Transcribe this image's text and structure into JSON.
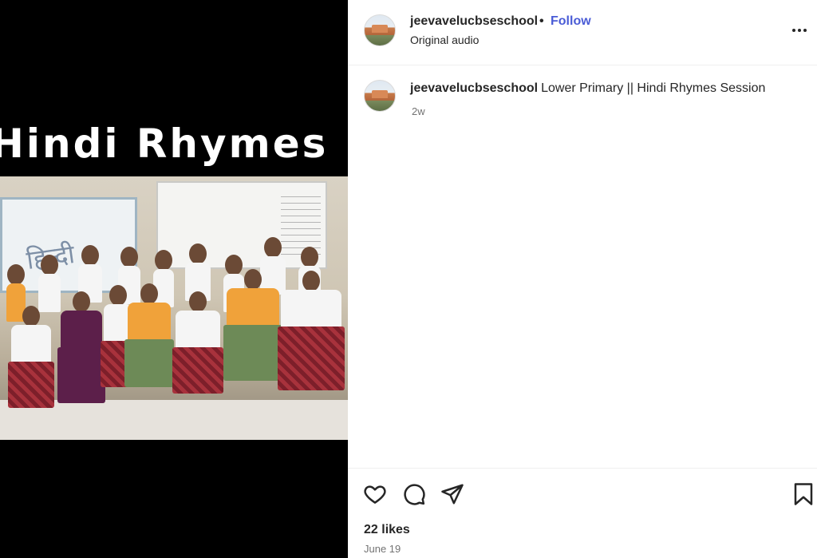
{
  "post": {
    "username": "jeevavelucbseschool",
    "separator": "•",
    "follow_label": "Follow",
    "audio": "Original audio"
  },
  "media": {
    "title_text": "Hindi Rhymes",
    "board_text": "हिन्दी"
  },
  "caption": {
    "username": "jeevavelucbseschool",
    "text": "Lower Primary || Hindi Rhymes Session",
    "age": "2w"
  },
  "actions": {
    "likes": "22 likes",
    "date": "June 19"
  },
  "colors": {
    "follow": "#4a5cd6",
    "media_bg": "#000000",
    "muted": "#737373",
    "text": "#262626"
  },
  "icons": [
    "more-options-icon",
    "heart-icon",
    "comment-icon",
    "share-icon",
    "bookmark-icon"
  ]
}
